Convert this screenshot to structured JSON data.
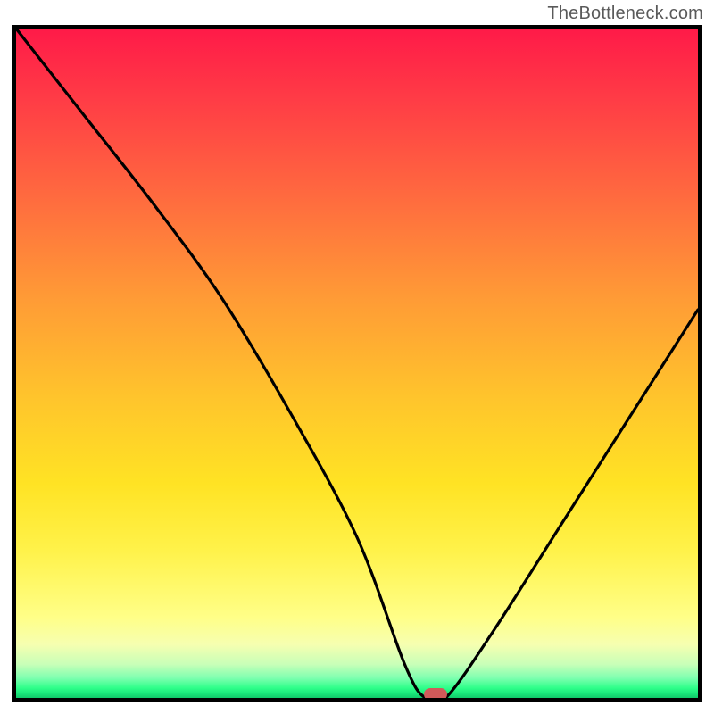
{
  "watermark": "TheBottleneck.com",
  "colors": {
    "frame": "#000000",
    "curve": "#000000",
    "marker": "#d05a5a",
    "gradient_top": "#ff1a48",
    "gradient_mid": "#ffe324",
    "gradient_green": "#19e87a"
  },
  "chart_data": {
    "type": "line",
    "title": "",
    "xlabel": "",
    "ylabel": "",
    "xlim": [
      0,
      100
    ],
    "ylim": [
      0,
      100
    ],
    "grid": false,
    "legend": false,
    "series": [
      {
        "name": "bottleneck-curve",
        "x": [
          0,
          10,
          20,
          30,
          40,
          50,
          57,
          60,
          63,
          70,
          80,
          90,
          100
        ],
        "values": [
          100,
          87,
          74,
          60,
          43,
          24,
          5,
          0,
          0,
          10,
          26,
          42,
          58
        ]
      }
    ],
    "marker": {
      "x": 61.5,
      "y": 0
    },
    "annotations": []
  }
}
